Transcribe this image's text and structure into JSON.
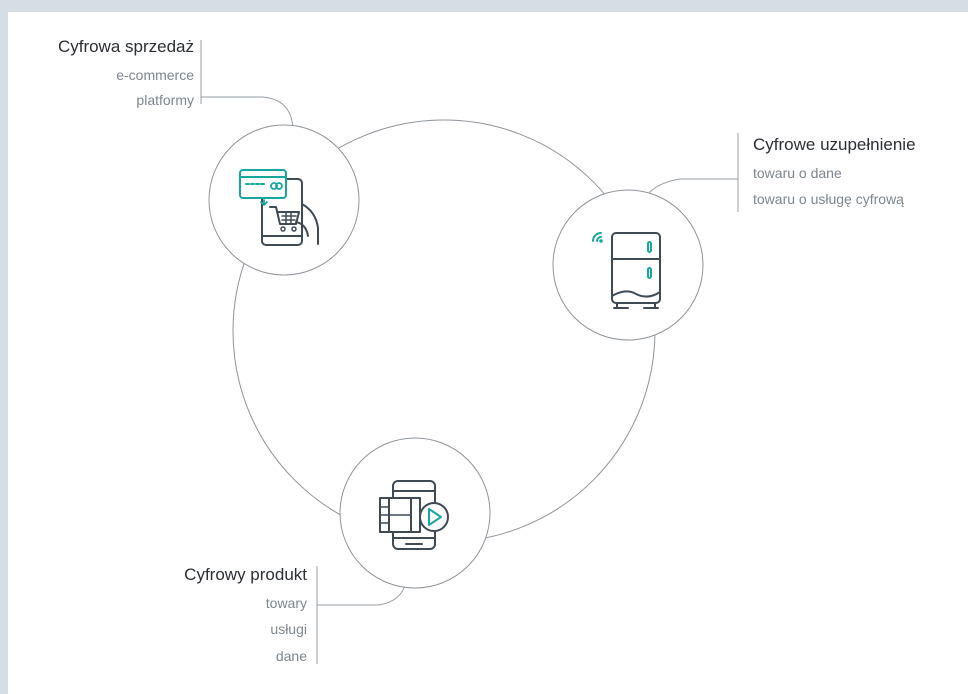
{
  "nodes": [
    {
      "id": "sales",
      "title": "Cyfrowa sprzedaż",
      "lines": [
        "e-commerce",
        "platformy"
      ],
      "icon": "card-payment-cart-icon"
    },
    {
      "id": "supplement",
      "title": "Cyfrowe uzupełnienie",
      "lines": [
        "towaru o dane",
        "towaru o usługę cyfrową"
      ],
      "icon": "smart-fridge-icon"
    },
    {
      "id": "product",
      "title": "Cyfrowy produkt",
      "lines": [
        "towary",
        "usługi",
        "dane"
      ],
      "icon": "mobile-video-icon"
    }
  ],
  "colors": {
    "background": "#d7dde4",
    "panel": "#ffffff",
    "line": "#9aa0a6",
    "icon_stroke": "#3f4a55",
    "accent": "#17a7a0",
    "title_text": "#2b2f33",
    "sub_text": "#7d858d"
  }
}
